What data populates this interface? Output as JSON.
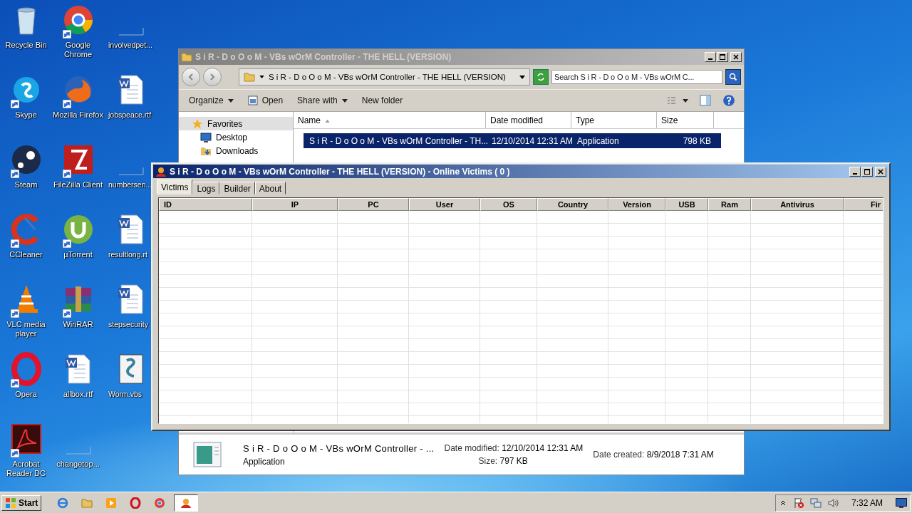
{
  "desktop_icons": [
    {
      "label": "Recycle Bin",
      "shortcut": false
    },
    {
      "label": "Skype",
      "shortcut": true
    },
    {
      "label": "Steam",
      "shortcut": true
    },
    {
      "label": "CCleaner",
      "shortcut": true
    },
    {
      "label": "VLC media player",
      "shortcut": true
    },
    {
      "label": "Opera",
      "shortcut": true
    },
    {
      "label": "Acrobat Reader DC",
      "shortcut": true
    },
    {
      "label": "Google Chrome",
      "shortcut": true
    },
    {
      "label": "Mozilla Firefox",
      "shortcut": true
    },
    {
      "label": "FileZilla Client",
      "shortcut": true
    },
    {
      "label": "µTorrent",
      "shortcut": true
    },
    {
      "label": "WinRAR",
      "shortcut": true
    },
    {
      "label": "allbox.rtf",
      "shortcut": false
    },
    {
      "label": "changetop...",
      "shortcut": false
    },
    {
      "label": "involvedpet...",
      "shortcut": false
    },
    {
      "label": "jobspeace.rtf",
      "shortcut": false
    },
    {
      "label": "numbersen...",
      "shortcut": false
    },
    {
      "label": "resultlong.rt",
      "shortcut": false
    },
    {
      "label": "stepsecurity",
      "shortcut": false
    },
    {
      "label": "Worm.vbs",
      "shortcut": false
    }
  ],
  "explorer": {
    "title": "S i R - D o O o M - VBs wOrM Controller - THE HELL (VERSION)",
    "address": "S i R - D o O o M - VBs wOrM Controller - THE HELL (VERSION)",
    "search": {
      "placeholder": "Search S i R - D o O o M - VBs wOrM C..."
    },
    "toolbar": [
      {
        "label": "Organize",
        "dropdown": true
      },
      {
        "label": "Open",
        "dropdown": false
      },
      {
        "label": "Share with",
        "dropdown": true
      },
      {
        "label": "New folder",
        "dropdown": false
      }
    ],
    "nav": [
      {
        "label": "Favorites",
        "kind": "star",
        "selected": true
      },
      {
        "label": "Desktop",
        "kind": "desktop",
        "selected": false
      },
      {
        "label": "Downloads",
        "kind": "downloads",
        "selected": false
      }
    ],
    "columns": [
      "Name",
      "Date modified",
      "Type",
      "Size"
    ],
    "files": [
      {
        "name": "S i R - D o O o M - VBs wOrM Controller - TH...",
        "date": "12/10/2014 12:31 AM",
        "type": "Application",
        "size": "798 KB",
        "selected": true
      }
    ],
    "details": {
      "name": "S i R - D o O o M - VBs wOrM Controller - ...",
      "type": "Application",
      "modified_label": "Date modified:",
      "modified": "12/10/2014 12:31 AM",
      "size_label": "Size:",
      "size": "797 KB",
      "created_label": "Date created:",
      "created": "8/9/2018 7:31 AM"
    }
  },
  "controller": {
    "title": "S i R - D o O o M - VBs wOrM Controller - THE HELL (VERSION) - Online Victims ( 0 )",
    "tabs": [
      {
        "label": "Victims",
        "selected": true
      },
      {
        "label": "Logs",
        "selected": false
      },
      {
        "label": "Builder",
        "selected": false
      },
      {
        "label": "About",
        "selected": false
      }
    ],
    "columns": [
      "ID",
      "IP",
      "PC",
      "User",
      "OS",
      "Country",
      "Version",
      "USB",
      "Ram",
      "Antivirus",
      "Fir"
    ]
  },
  "taskbar": {
    "start": "Start",
    "apps": [
      {
        "selected": false
      },
      {
        "selected": false
      },
      {
        "selected": false
      },
      {
        "selected": false
      },
      {
        "selected": false
      },
      {
        "selected": true
      }
    ],
    "clock": "7:32 AM"
  }
}
